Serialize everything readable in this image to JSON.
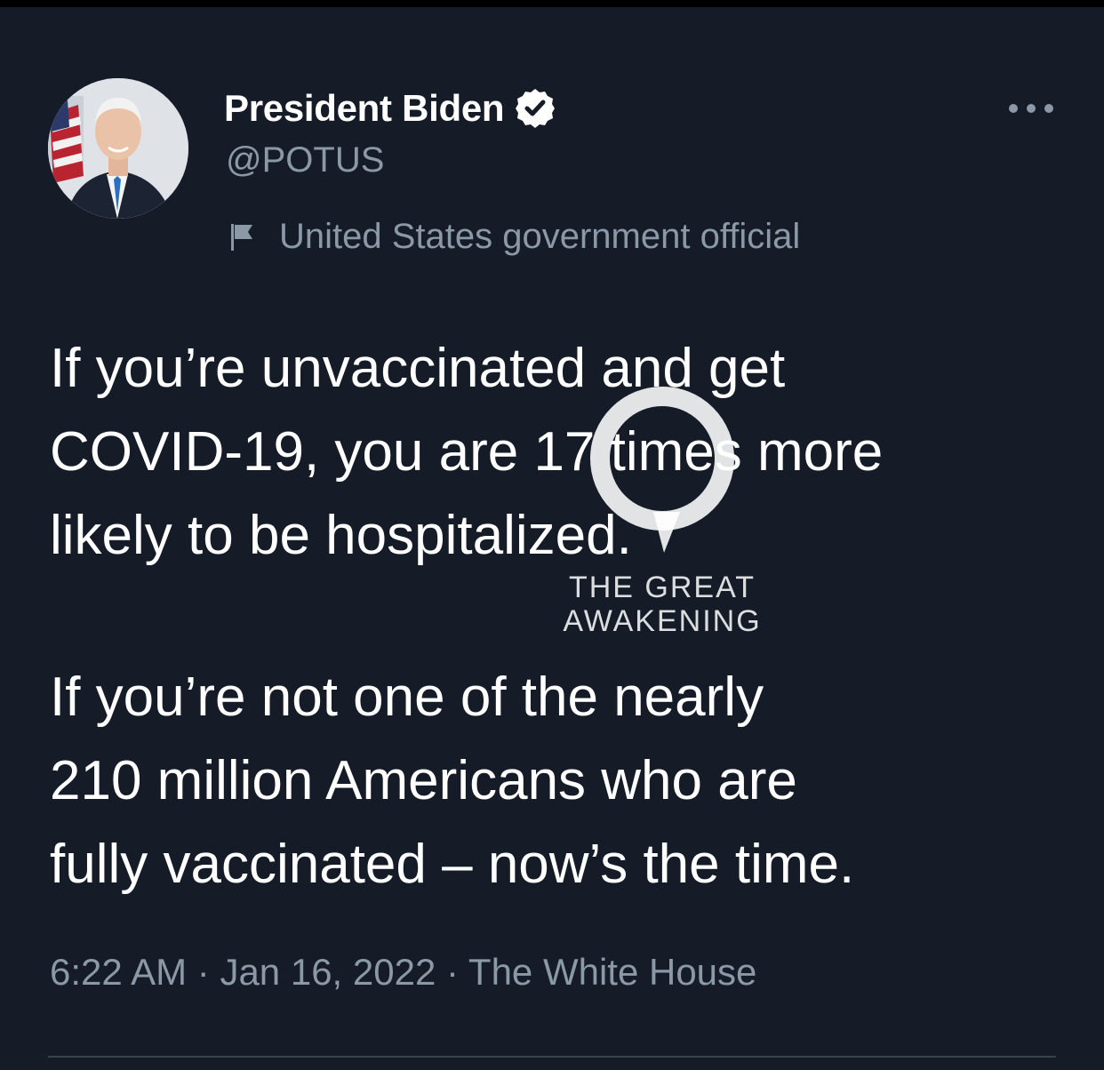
{
  "tweet": {
    "author": {
      "name": "President Biden",
      "handle": "@POTUS",
      "label": "United States government official"
    },
    "text_paragraph_1": "If you’re unvaccinated and get\nCOVID-19, you are 17 times more\nlikely to be hospitalized.",
    "text_paragraph_2": "If you’re not one of the nearly\n210 million Americans who are\nfully vaccinated – now’s the time.",
    "time": "6:22 AM",
    "date": "Jan 16, 2022",
    "source": "The White House",
    "separator": "·"
  },
  "watermark": {
    "line1": "THE GREAT",
    "line2": "AWAKENING"
  },
  "colors": {
    "background": "#151c28",
    "text_primary": "#ffffff",
    "text_secondary": "#8b98a5",
    "divider": "#38444d"
  },
  "icons": {
    "verified": "verified-badge-icon",
    "label": "flag-icon",
    "more": "more-horizontal-icon",
    "watermark": "q-logo-icon"
  }
}
